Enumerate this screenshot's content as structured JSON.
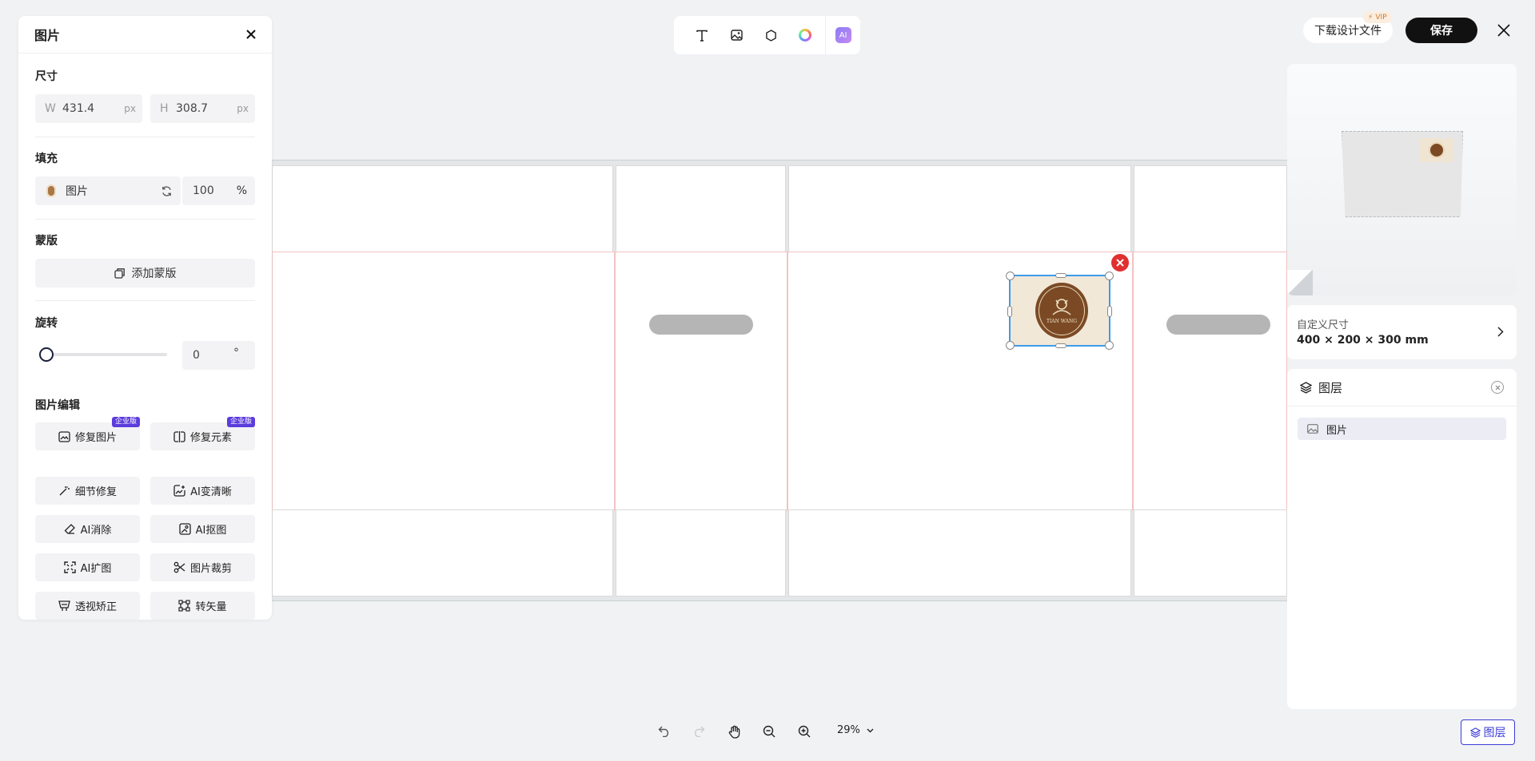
{
  "left_panel": {
    "title": "图片",
    "size": {
      "title": "尺寸",
      "w_label": "W",
      "w_value": "431.4",
      "w_unit": "px",
      "h_label": "H",
      "h_value": "308.7",
      "h_unit": "px"
    },
    "fill": {
      "title": "填充",
      "type_label": "图片",
      "opacity_value": "100",
      "opacity_unit": "%"
    },
    "mask": {
      "title": "蒙版",
      "add_label": "添加蒙版"
    },
    "rotate": {
      "title": "旋转",
      "value": "0",
      "unit": "°",
      "slider_fraction": 0
    },
    "image_edit": {
      "title": "图片编辑",
      "badge": "企业版",
      "buttons": [
        {
          "label": "修复图片",
          "icon": "image-repair-icon"
        },
        {
          "label": "修复元素",
          "icon": "element-repair-icon"
        },
        {
          "label": "细节修复",
          "icon": "magic-wand-icon"
        },
        {
          "label": "AI变清晰",
          "icon": "sharpen-icon"
        },
        {
          "label": "AI消除",
          "icon": "eraser-icon"
        },
        {
          "label": "AI抠图",
          "icon": "cutout-icon"
        },
        {
          "label": "AI扩图",
          "icon": "expand-icon"
        },
        {
          "label": "图片裁剪",
          "icon": "scissors-icon"
        },
        {
          "label": "透视矫正",
          "icon": "perspective-icon"
        },
        {
          "label": "转矢量",
          "icon": "vector-icon"
        }
      ]
    }
  },
  "toolbar": {
    "ai_label": "AI"
  },
  "header": {
    "download_label": "下载设计文件",
    "vip_label": "VIP",
    "save_label": "保存"
  },
  "logo": {
    "text": "TIAN WANG"
  },
  "size_card": {
    "label": "自定义尺寸",
    "value": "400 × 200 × 300 mm"
  },
  "layers": {
    "title": "图层",
    "items": [
      {
        "label": "图片"
      }
    ]
  },
  "bottom": {
    "zoom": "29%",
    "layers_button": "图层"
  },
  "colors": {
    "accent": "#3a3ad6",
    "save_bg": "#111111",
    "selection": "#3d9be9",
    "delete": "#e03030",
    "logo_brown": "#7b4a24"
  }
}
